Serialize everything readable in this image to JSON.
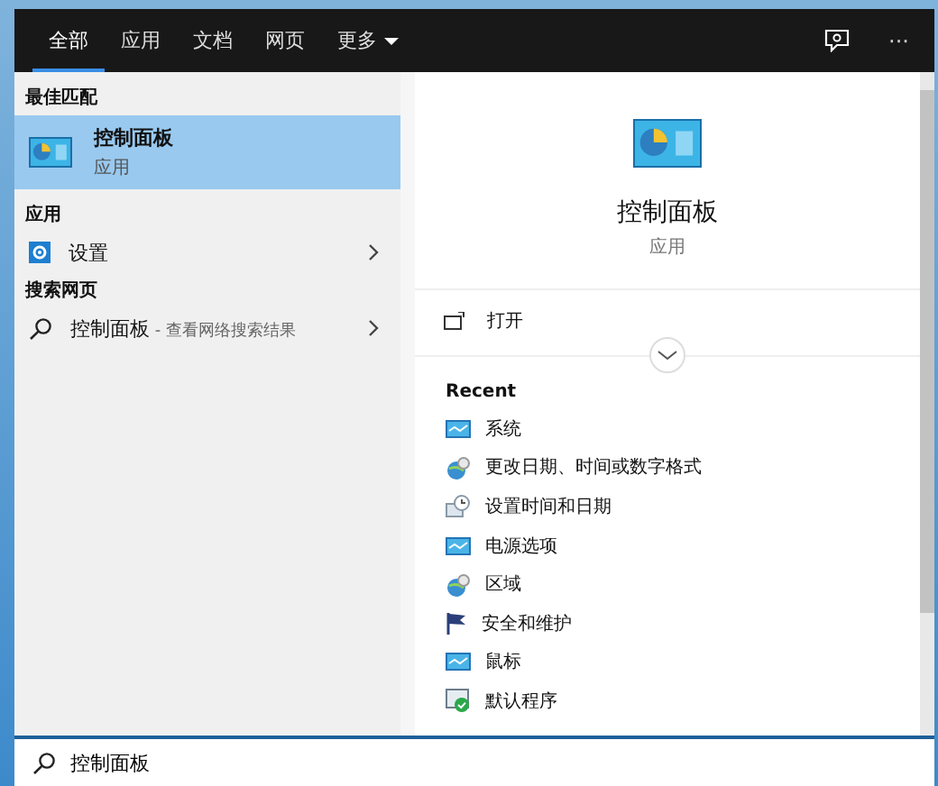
{
  "tabs": [
    {
      "label": "全部",
      "selected": true
    },
    {
      "label": "应用",
      "selected": false
    },
    {
      "label": "文档",
      "selected": false
    },
    {
      "label": "网页",
      "selected": false
    },
    {
      "label": "更多",
      "selected": false,
      "kind": "dropdown"
    }
  ],
  "toolbar": {
    "more": "···"
  },
  "results": [
    {
      "kind": "heading",
      "label": "最佳匹配"
    },
    {
      "kind": "best",
      "title": "控制面板",
      "subtitle": "应用",
      "selected": true
    },
    {
      "kind": "heading",
      "label": "应用"
    },
    {
      "kind": "app",
      "title": "设置",
      "selected": false
    },
    {
      "kind": "heading",
      "label": "搜索网页"
    },
    {
      "kind": "web",
      "title": "控制面板",
      "suffix": " - 查看网络搜索结果",
      "selected": false
    }
  ],
  "preview": {
    "title": "控制面板",
    "subtitle": "应用",
    "actions": [
      {
        "label": "打开"
      }
    ],
    "recent_heading": "Recent",
    "recent": [
      {
        "label": "系统",
        "kind": "monitor"
      },
      {
        "label": "更改日期、时间或数字格式",
        "kind": "globe"
      },
      {
        "label": "设置时间和日期",
        "kind": "clock"
      },
      {
        "label": "电源选项",
        "kind": "monitor"
      },
      {
        "label": "区域",
        "kind": "globe"
      },
      {
        "label": "安全和维护",
        "kind": "flag"
      },
      {
        "label": "鼠标",
        "kind": "monitor"
      },
      {
        "label": "默认程序",
        "kind": "check"
      }
    ]
  },
  "search": {
    "value": "控制面板"
  }
}
